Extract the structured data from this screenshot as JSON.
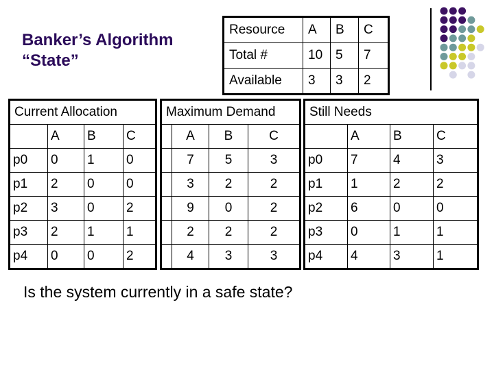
{
  "title": {
    "line1": "Banker’s Algorithm",
    "line2": "“State”"
  },
  "resource_table": {
    "header": [
      "Resource",
      "A",
      "B",
      "C"
    ],
    "rows": [
      [
        "Total #",
        "10",
        "5",
        "7"
      ],
      [
        "Available",
        "3",
        "3",
        "2"
      ]
    ]
  },
  "current_allocation": {
    "title": "Current Allocation",
    "columns": [
      "",
      "A",
      "B",
      "C"
    ],
    "rows": [
      [
        "p0",
        "0",
        "1",
        "0"
      ],
      [
        "p1",
        "2",
        "0",
        "0"
      ],
      [
        "p2",
        "3",
        "0",
        "2"
      ],
      [
        "p3",
        "2",
        "1",
        "1"
      ],
      [
        "p4",
        "0",
        "0",
        "2"
      ]
    ]
  },
  "maximum_demand": {
    "title": "Maximum Demand",
    "columns": [
      "",
      "A",
      "B",
      "C"
    ],
    "rows": [
      [
        "",
        "7",
        "5",
        "3"
      ],
      [
        "",
        "3",
        "2",
        "2"
      ],
      [
        "",
        "9",
        "0",
        "2"
      ],
      [
        "",
        "2",
        "2",
        "2"
      ],
      [
        "",
        "4",
        "3",
        "3"
      ]
    ]
  },
  "still_needs": {
    "title": "Still Needs",
    "columns": [
      "",
      "A",
      "B",
      "C"
    ],
    "rows": [
      [
        "p0",
        "7",
        "4",
        "3"
      ],
      [
        "p1",
        "1",
        "2",
        "2"
      ],
      [
        "p2",
        "6",
        "0",
        "0"
      ],
      [
        "p3",
        "0",
        "1",
        "1"
      ],
      [
        "p4",
        "4",
        "3",
        "1"
      ]
    ]
  },
  "question": "Is the system currently in a safe state?",
  "decoration": {
    "colors": {
      "purple": "#3d1262",
      "teal": "#6f9a9a",
      "yellow": "#c9c82a",
      "lavender": "#d6d6e8"
    }
  }
}
